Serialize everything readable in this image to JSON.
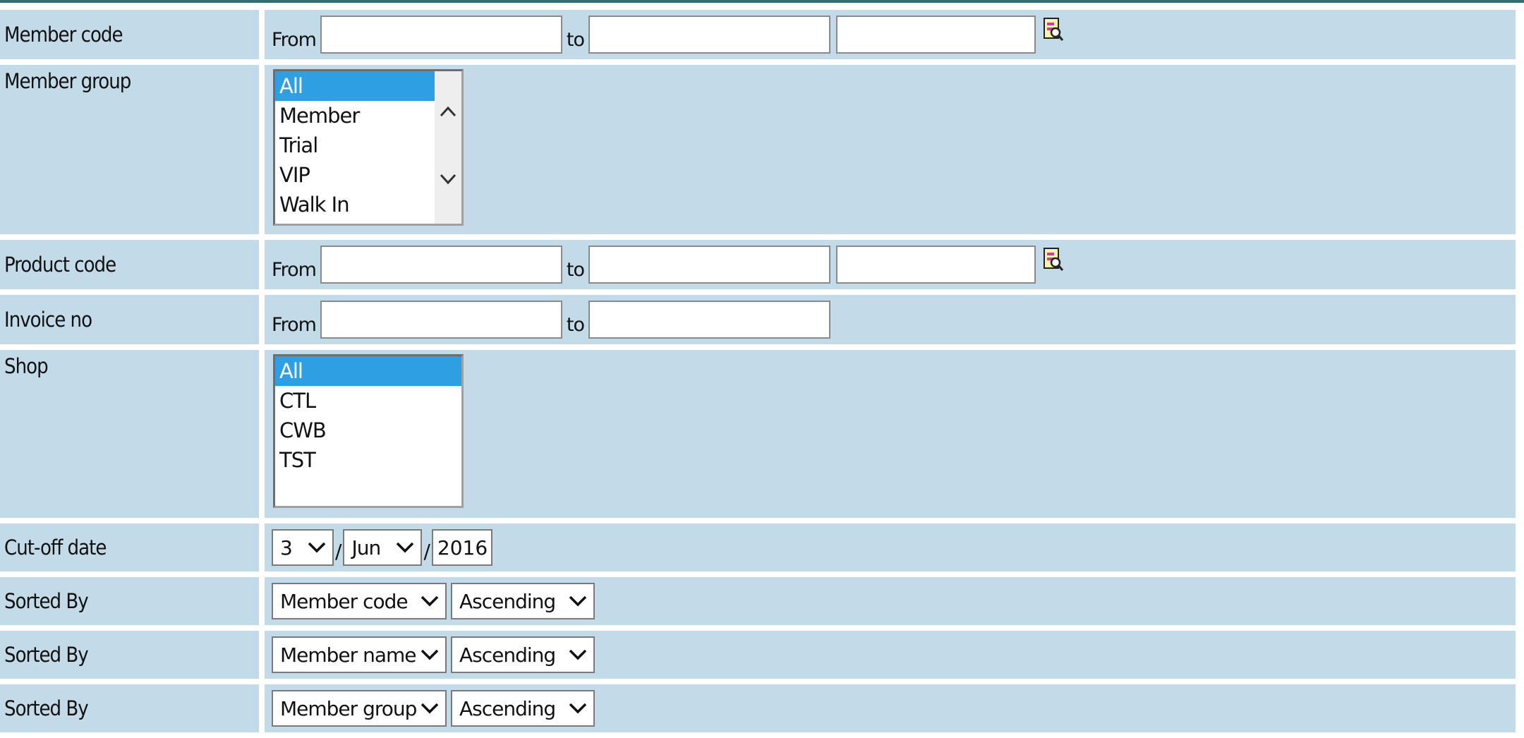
{
  "rows": {
    "member_code": {
      "label": "Member code",
      "from": "From",
      "to": "to",
      "from_value": "",
      "to_value": "",
      "extra_value": ""
    },
    "member_group": {
      "label": "Member group",
      "options": [
        "All",
        "Member",
        "Trial",
        "VIP",
        "Walk In"
      ],
      "selected": "All"
    },
    "product_code": {
      "label": "Product code",
      "from": "From",
      "to": "to",
      "from_value": "",
      "to_value": "",
      "extra_value": ""
    },
    "invoice_no": {
      "label": "Invoice no",
      "from": "From",
      "to": "to",
      "from_value": "",
      "to_value": ""
    },
    "shop": {
      "label": "Shop",
      "options": [
        "All",
        "CTL",
        "CWB",
        "TST"
      ],
      "selected": "All"
    },
    "cutoff_date": {
      "label": "Cut-off date",
      "day": "3",
      "month": "Jun",
      "year": "2016",
      "sep": "/"
    },
    "sorted_by": [
      {
        "label": "Sorted By",
        "field": "Member code",
        "order": "Ascending"
      },
      {
        "label": "Sorted By",
        "field": "Member name",
        "order": "Ascending"
      },
      {
        "label": "Sorted By",
        "field": "Member group",
        "order": "Ascending"
      }
    ]
  },
  "colors": {
    "row_bg": "#c3dae8",
    "selected_option": "#2f9fe3",
    "top_rule": "#2f6f73"
  },
  "icons": {
    "lookup": "lookup-icon"
  }
}
